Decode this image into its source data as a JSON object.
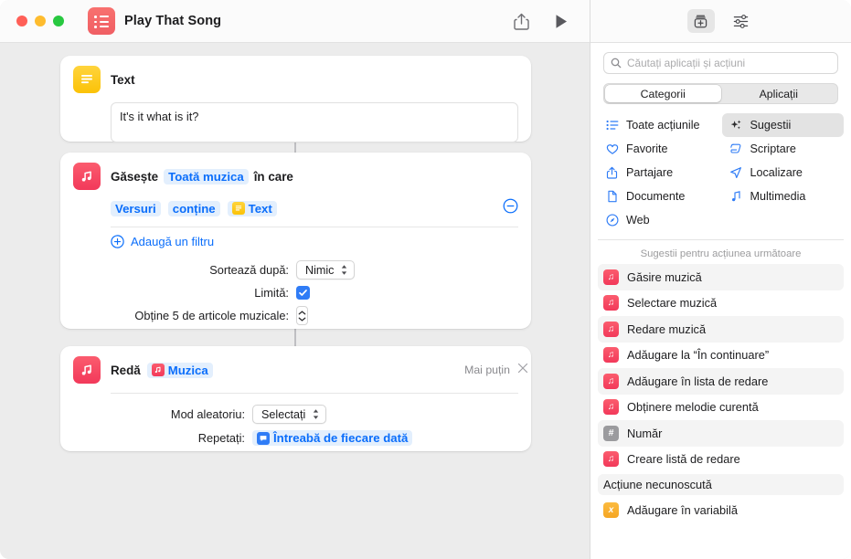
{
  "window": {
    "title": "Play That Song",
    "doc_icon": "shortcut-list-icon",
    "share_icon": "share-icon",
    "run_icon": "play-icon"
  },
  "library_panel": {
    "toggles": [
      {
        "name": "action-library-icon",
        "label": "Bibliotecă acțiuni",
        "active": true
      },
      {
        "name": "shortcut-details-icon",
        "label": "Detalii scurtătură",
        "active": false
      }
    ],
    "search": {
      "placeholder": "Căutați aplicații și acțiuni",
      "value": "",
      "icon": "search-icon"
    },
    "segments": [
      {
        "label": "Categorii",
        "active": true
      },
      {
        "label": "Aplicații",
        "active": false
      }
    ],
    "categories": [
      {
        "label": "Toate acțiunile",
        "icon": "list-bullet-icon",
        "selected": false
      },
      {
        "label": "Sugestii",
        "icon": "sparkles-icon",
        "selected": true
      },
      {
        "label": "Favorite",
        "icon": "heart-icon",
        "selected": false
      },
      {
        "label": "Scriptare",
        "icon": "scroll-icon",
        "selected": false
      },
      {
        "label": "Partajare",
        "icon": "share-icon",
        "selected": false
      },
      {
        "label": "Localizare",
        "icon": "location-arrow-icon",
        "selected": false
      },
      {
        "label": "Documente",
        "icon": "document-icon",
        "selected": false
      },
      {
        "label": "Multimedia",
        "icon": "music-note-icon",
        "selected": false
      },
      {
        "label": "Web",
        "icon": "safari-compass-icon",
        "selected": false
      }
    ],
    "suggestions_header": "Sugestii pentru acțiunea următoare",
    "suggestions": [
      {
        "label": "Găsire muzică",
        "badge": "music",
        "glyph": "♫"
      },
      {
        "label": "Selectare muzică",
        "badge": "music",
        "glyph": "♫"
      },
      {
        "label": "Redare muzică",
        "badge": "music",
        "glyph": "♫"
      },
      {
        "label": "Adăugare la “În continuare”",
        "badge": "music",
        "glyph": "♫"
      },
      {
        "label": "Adăugare în lista de redare",
        "badge": "music",
        "glyph": "♫"
      },
      {
        "label": "Obținere melodie curentă",
        "badge": "music",
        "glyph": "♫"
      },
      {
        "label": "Număr",
        "badge": "gray",
        "glyph": "#"
      },
      {
        "label": "Creare listă de redare",
        "badge": "music",
        "glyph": "♫"
      }
    ],
    "unknown_section": "Acțiune necunoscută",
    "unknown_items": [
      {
        "label": "Adăugare în variabilă",
        "badge": "orange",
        "glyph": "x"
      }
    ]
  },
  "workflow": {
    "text_action": {
      "icon": "text-action-icon",
      "title": "Text",
      "value": "It's it what is it?"
    },
    "find_action": {
      "icon": "music-action-icon",
      "title": "Găsește",
      "source_token": "Toată muzica",
      "title_suffix": "în care",
      "filter": {
        "field": "Versuri",
        "operator": "conține",
        "value_token": "Text",
        "value_icon": "text-variable-icon",
        "remove_icon": "minus-circle-icon"
      },
      "add_filter": {
        "label": "Adaugă un filtru",
        "icon": "plus-circle-icon"
      },
      "sort_label": "Sortează după:",
      "sort_value": "Nimic",
      "limit_label": "Limită:",
      "limit_checked": true,
      "count_label": "Obține 5 de articole muzicale:",
      "count_value": "5"
    },
    "play_action": {
      "icon": "music-action-icon",
      "title": "Redă",
      "target_token": "Muzica",
      "target_icon": "music-variable-icon",
      "less_label": "Mai puțin",
      "close_icon": "close-icon",
      "shuffle_label": "Mod aleatoriu:",
      "shuffle_value": "Selectați",
      "repeat_label": "Repetați:",
      "repeat_value": "Întreabă de fiecare dată",
      "repeat_icon": "ask-each-time-icon"
    }
  },
  "colors": {
    "accent_blue": "#0b6efb",
    "token_bg": "#e3effd",
    "music_red": "#f2395a",
    "text_yellow": "#fbc207",
    "canvas": "#ececec"
  }
}
